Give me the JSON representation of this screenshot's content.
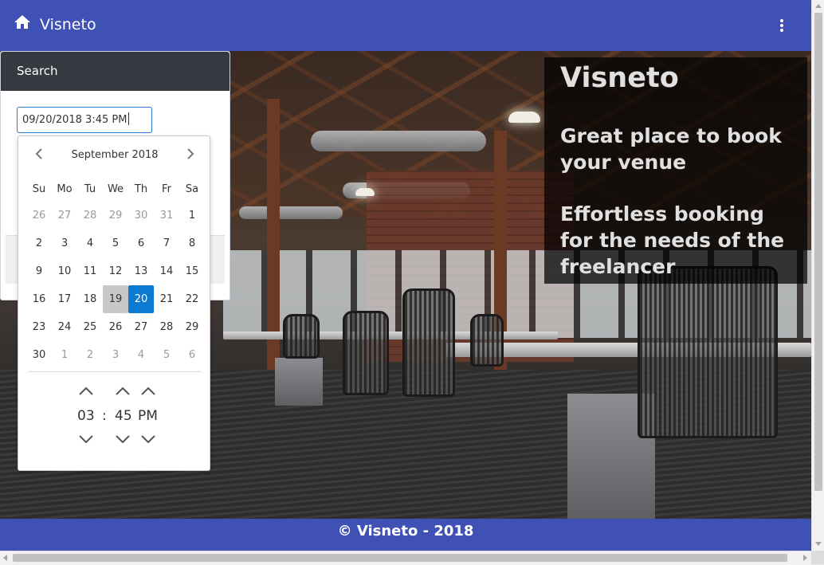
{
  "navbar": {
    "brand": "Visneto",
    "home_icon": "home-icon",
    "menu_icon": "more-vertical-icon",
    "background": "#3f51b5"
  },
  "search": {
    "title": "Search",
    "input_value": "09/20/2018 3:45 PM"
  },
  "datepicker": {
    "month_label": "September 2018",
    "prev_icon": "chevron-left-icon",
    "next_icon": "chevron-right-icon",
    "weekdays": [
      "Su",
      "Mo",
      "Tu",
      "We",
      "Th",
      "Fr",
      "Sa"
    ],
    "weeks": [
      [
        "26",
        "27",
        "28",
        "29",
        "30",
        "31",
        "1"
      ],
      [
        "2",
        "3",
        "4",
        "5",
        "6",
        "7",
        "8"
      ],
      [
        "9",
        "10",
        "11",
        "12",
        "13",
        "14",
        "15"
      ],
      [
        "16",
        "17",
        "18",
        "19",
        "20",
        "21",
        "22"
      ],
      [
        "23",
        "24",
        "25",
        "26",
        "27",
        "28",
        "29"
      ],
      [
        "30",
        "1",
        "2",
        "3",
        "4",
        "5",
        "6"
      ]
    ],
    "today": "19",
    "selected": "20",
    "selected_color": "#0a7bd0",
    "time": {
      "hour": "03",
      "separator": ":",
      "minute": "45",
      "period": "PM"
    }
  },
  "hero": {
    "title": "Visneto",
    "tagline_1": "Great place to book your venue",
    "tagline_2": "Effortless booking for the needs of the freelancer"
  },
  "footer": {
    "text": "© Visneto - 2018"
  }
}
